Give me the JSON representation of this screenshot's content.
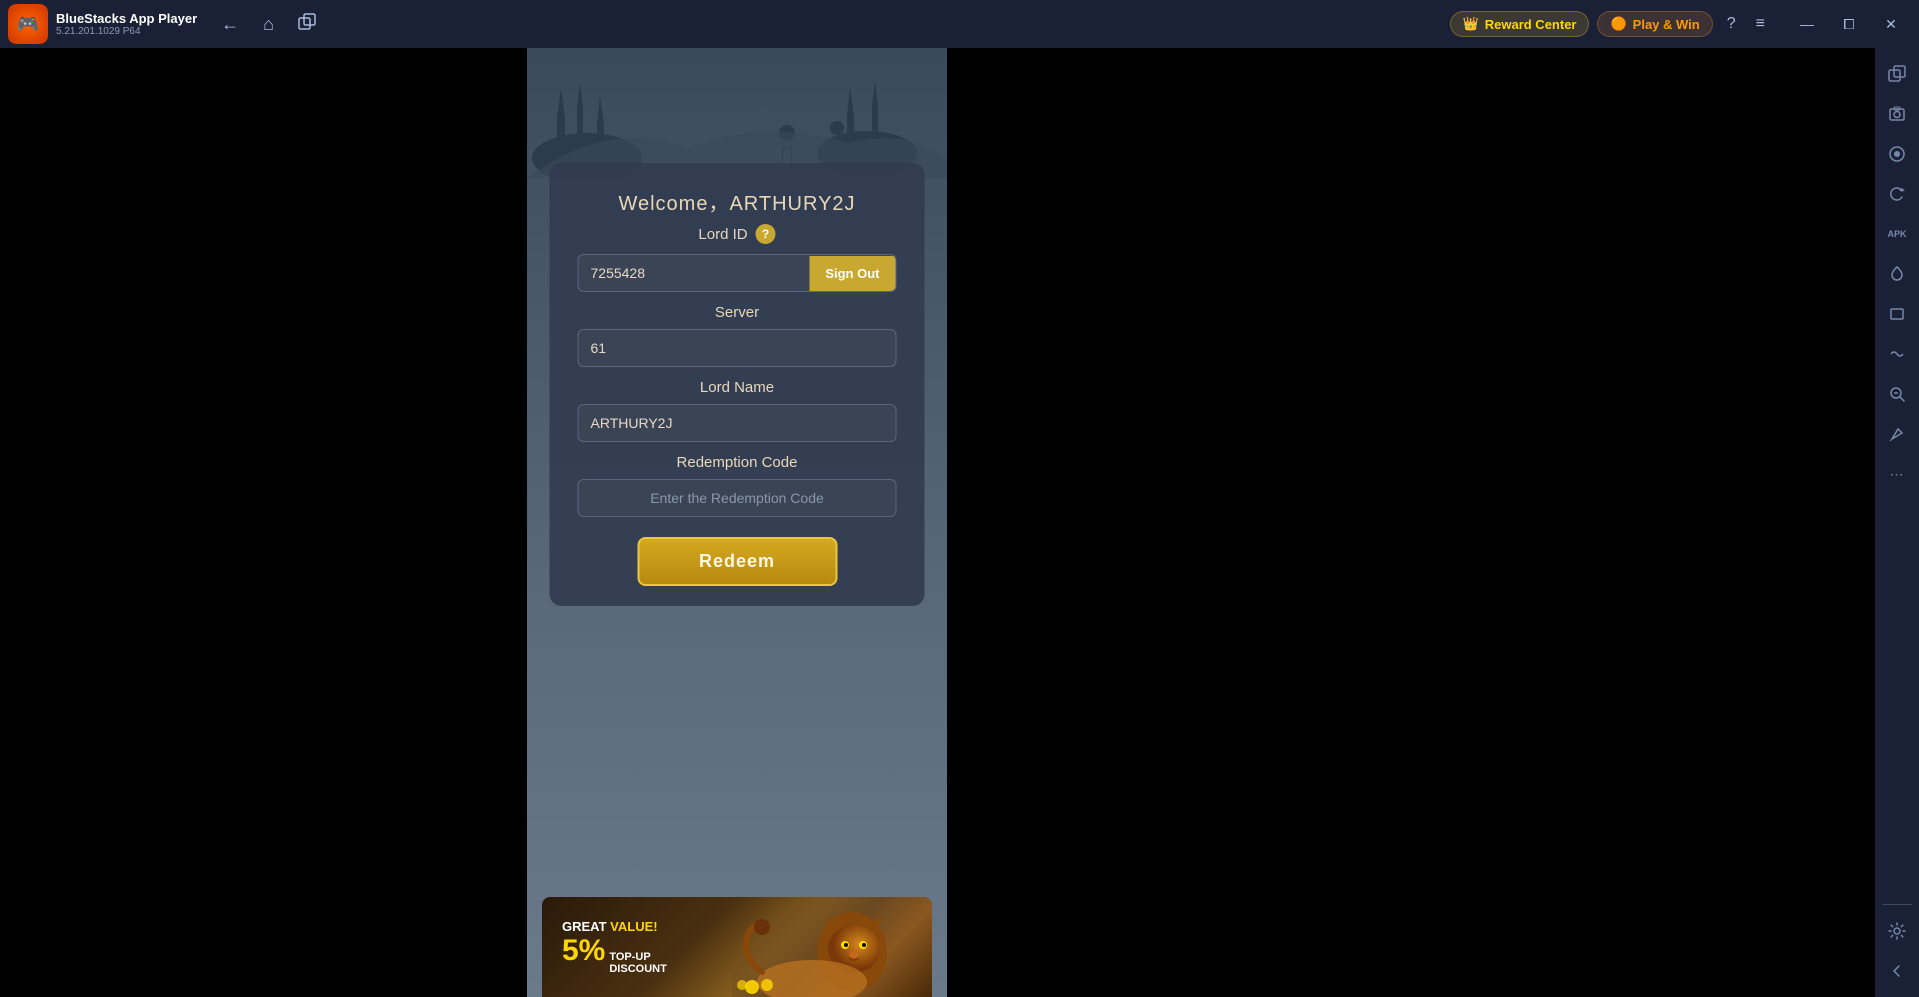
{
  "titlebar": {
    "logo_emoji": "🎮",
    "app_name": "BlueStacks App Player",
    "app_version": "5.21.201.1029  P64",
    "nav": {
      "back_label": "←",
      "home_label": "⌂",
      "multi_label": "⧉"
    },
    "reward_center_label": "Reward Center",
    "play_win_label": "Play & Win",
    "help_label": "?",
    "menu_label": "≡",
    "minimize_label": "—",
    "maximize_label": "⧠",
    "close_label": "✕"
  },
  "dialog": {
    "welcome_title": "Welcome，ARTHURY2J",
    "lord_id_label": "Lord ID",
    "lord_id_value": "7255428",
    "sign_out_label": "Sign Out",
    "server_label": "Server",
    "server_value": "61",
    "lord_name_label": "Lord Name",
    "lord_name_value": "ARTHURY2J",
    "redemption_code_label": "Redemption Code",
    "redemption_code_placeholder": "Enter the Redemption Code",
    "redeem_label": "Redeem"
  },
  "banner": {
    "great_value": "GREAT",
    "value_label": "VALUE!",
    "percent": "5%",
    "topup_label": "TOP-UP",
    "discount_label": "DISCOUNT"
  },
  "sidebar": {
    "icons": [
      "⊞",
      "☰",
      "↺",
      "◎",
      "⚙",
      "APK",
      "⬡",
      "⊡",
      "⊕",
      "✎",
      "⋯",
      "⚙",
      "←"
    ]
  }
}
